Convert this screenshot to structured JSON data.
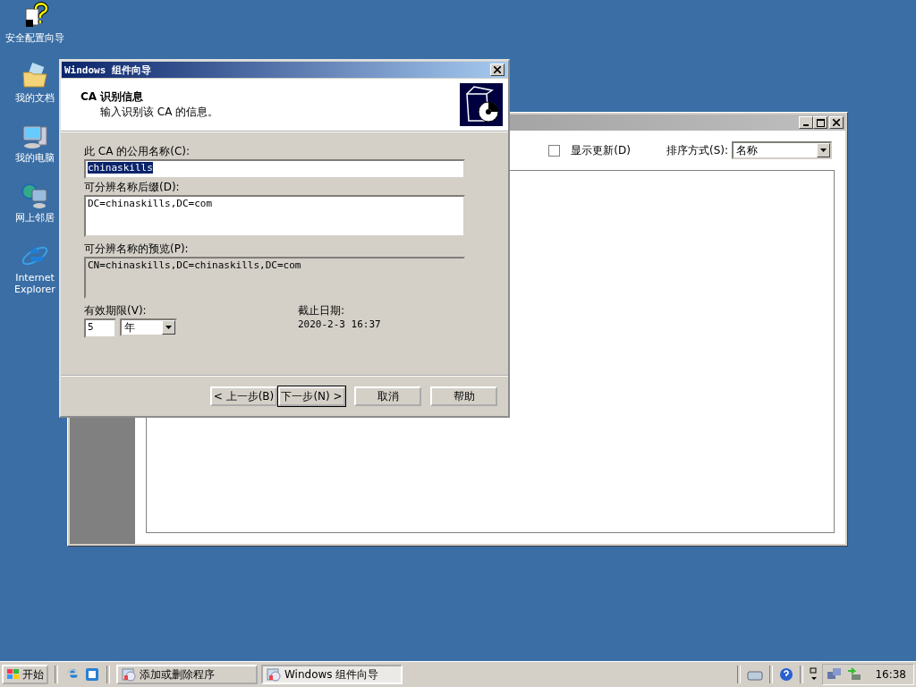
{
  "desktop_icons": [
    {
      "label": "安全配置向导",
      "kind": "wizard"
    },
    {
      "label": "我的文档",
      "kind": "documents"
    },
    {
      "label": "我的电脑",
      "kind": "computer"
    },
    {
      "label": "网上邻居",
      "kind": "network"
    },
    {
      "label": "Internet Explorer",
      "kind": "browser"
    }
  ],
  "background_window": {
    "show_updates": {
      "label": "显示更新(D)",
      "checked": false
    },
    "sort": {
      "label": "排序方式(S):",
      "value": "名称"
    }
  },
  "dialog": {
    "title": "Windows 组件向导",
    "header": {
      "title": "CA 识别信息",
      "subtitle": "输入识别该 CA 的信息。"
    },
    "common_name": {
      "label": "此 CA 的公用名称(C):",
      "value": "chinaskills",
      "selected": true
    },
    "suffix": {
      "label": "可分辨名称后缀(D):",
      "value": "DC=chinaskills,DC=com"
    },
    "preview": {
      "label": "可分辨名称的预览(P):",
      "value": "CN=chinaskills,DC=chinaskills,DC=com"
    },
    "validity": {
      "label": "有效期限(V):",
      "value": "5",
      "unit": "年"
    },
    "expiry": {
      "label": "截止日期:",
      "value": "2020-2-3 16:37"
    },
    "buttons": [
      {
        "label": "< 上一步(B)",
        "default": false
      },
      {
        "label": "下一步(N) >",
        "default": true
      },
      {
        "label": "取消",
        "default": false
      },
      {
        "label": "帮助",
        "default": false
      }
    ]
  },
  "taskbar": {
    "start": "开始",
    "tasks": [
      {
        "label": "添加或删除程序",
        "selected": false
      },
      {
        "label": "Windows 组件向导",
        "selected": true
      }
    ],
    "clock": "16:38"
  }
}
